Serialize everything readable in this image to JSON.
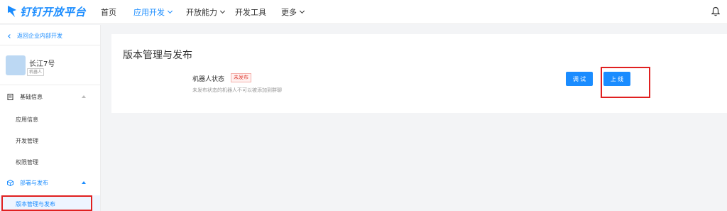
{
  "brand": {
    "name": "钉钉开放平台",
    "color": "#1a8cff"
  },
  "nav": {
    "items": [
      {
        "label": "首页",
        "active": false,
        "dropdown": false
      },
      {
        "label": "应用开发",
        "active": true,
        "dropdown": true
      },
      {
        "label": "开放能力",
        "active": false,
        "dropdown": true
      },
      {
        "label": "开发工具",
        "active": false,
        "dropdown": false
      },
      {
        "label": "更多",
        "active": false,
        "dropdown": true
      }
    ],
    "bell_icon": "bell-icon"
  },
  "sidebar": {
    "back_label": "返回企业内部开发",
    "app": {
      "name": "长江7号",
      "tag": "机器人"
    },
    "groups": [
      {
        "title": "基础信息",
        "icon": "document-icon",
        "items": [
          "应用信息",
          "开发管理",
          "权限管理"
        ]
      },
      {
        "title": "部署与发布",
        "icon": "cube-icon",
        "items": [
          "版本管理与发布"
        ]
      }
    ],
    "selected_item": "版本管理与发布"
  },
  "main": {
    "title": "版本管理与发布",
    "status_label": "机器人状态",
    "status_badge": "未发布",
    "status_desc": "未发布状态的机器人不可以被添加到群聊",
    "debug_button": "调 试",
    "online_button": "上 线"
  },
  "colors": {
    "accent": "#1a8cff",
    "highlight_box": "#e02020",
    "badge_red": "#e0443a"
  }
}
